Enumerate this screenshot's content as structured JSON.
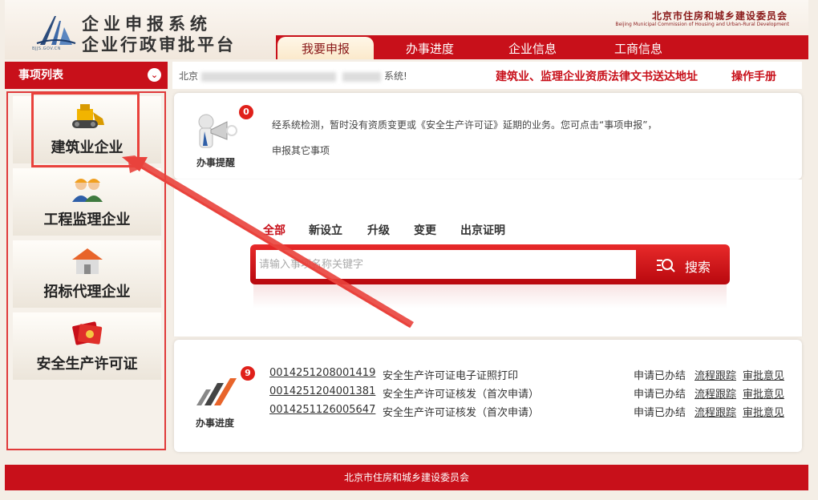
{
  "header": {
    "title_line1": "企业申报系统",
    "title_line2": "企业行政审批平台",
    "agency": "北京市住房和城乡建设委员会",
    "agency_en": "Beijing Municipal Commission of Housing and Urban-Rural Development",
    "logo_sub": "BJJS.GOV.CN"
  },
  "nav": {
    "tabs": [
      {
        "label": "我要申报",
        "active": true
      },
      {
        "label": "办事进度",
        "active": false
      },
      {
        "label": "企业信息",
        "active": false
      },
      {
        "label": "工商信息",
        "active": false
      }
    ]
  },
  "sidebar": {
    "title": "事项列表",
    "items": [
      {
        "label": "建筑业企业",
        "icon": "bulldozer-icon"
      },
      {
        "label": "工程监理企业",
        "icon": "workers-icon"
      },
      {
        "label": "招标代理企业",
        "icon": "house-icon"
      },
      {
        "label": "安全生产许可证",
        "icon": "certificate-icon"
      }
    ]
  },
  "notice": {
    "prefix": "北京",
    "suffix": "系统!",
    "link1": "建筑业、监理企业资质法律文书送达地址",
    "link2": "操作手册"
  },
  "reminder": {
    "caption": "办事提醒",
    "badge": "0",
    "line1": "经系统检测，暂时没有资质变更或《安全生产许可证》延期的业务。您可点击“事项申报”，",
    "line2": "申报其它事项"
  },
  "filters": [
    "全部",
    "新设立",
    "升级",
    "变更",
    "出京证明"
  ],
  "search": {
    "placeholder": "请输入事项名称关键字",
    "button": "搜索"
  },
  "progress": {
    "caption": "办事进度",
    "badge": "9",
    "rows": [
      {
        "id": "0014251208001419",
        "desc": "安全生产许可证电子证照打印",
        "status": "申请已办结",
        "link1": "流程跟踪",
        "link2": "审批意见"
      },
      {
        "id": "0014251204001381",
        "desc": "安全生产许可证核发（首次申请）",
        "status": "申请已办结",
        "link1": "流程跟踪",
        "link2": "审批意见"
      },
      {
        "id": "0014251126005647",
        "desc": "安全生产许可证核发（首次申请）",
        "status": "申请已办结",
        "link1": "流程跟踪",
        "link2": "审批意见"
      }
    ]
  },
  "footer": {
    "text": "北京市住房和城乡建设委员会"
  },
  "colors": {
    "brand_red": "#c8101a",
    "annotation_red": "#e9423c"
  }
}
